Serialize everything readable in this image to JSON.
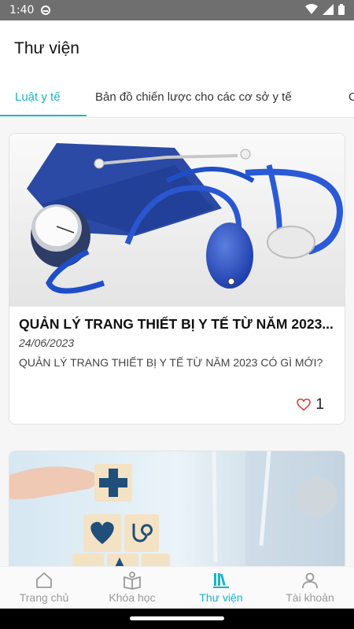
{
  "status": {
    "time": "1:40"
  },
  "header": {
    "title": "Thư viện"
  },
  "tabs": [
    {
      "label": "Luật y tế"
    },
    {
      "label": "Bản đồ chiến lược cho các cơ sở y tế"
    },
    {
      "label": "C"
    }
  ],
  "articles": [
    {
      "title": "QUẢN LÝ TRANG THIẾT BỊ Y TẾ TỪ NĂM 2023...",
      "date": "24/06/2023",
      "description": "QUẢN LÝ TRANG THIẾT BỊ Y TẾ TỪ NĂM 2023 CÓ GÌ MỚI?",
      "likes": "1"
    }
  ],
  "bottom_nav": [
    {
      "label": "Trang chủ",
      "icon": "home-icon"
    },
    {
      "label": "Khóa học",
      "icon": "book-icon"
    },
    {
      "label": "Thư viện",
      "icon": "library-icon"
    },
    {
      "label": "Tài khoản",
      "icon": "user-icon"
    }
  ],
  "colors": {
    "accent": "#19b4c8",
    "status_bar": "#6f6f6f",
    "heart": "#e0403c"
  }
}
